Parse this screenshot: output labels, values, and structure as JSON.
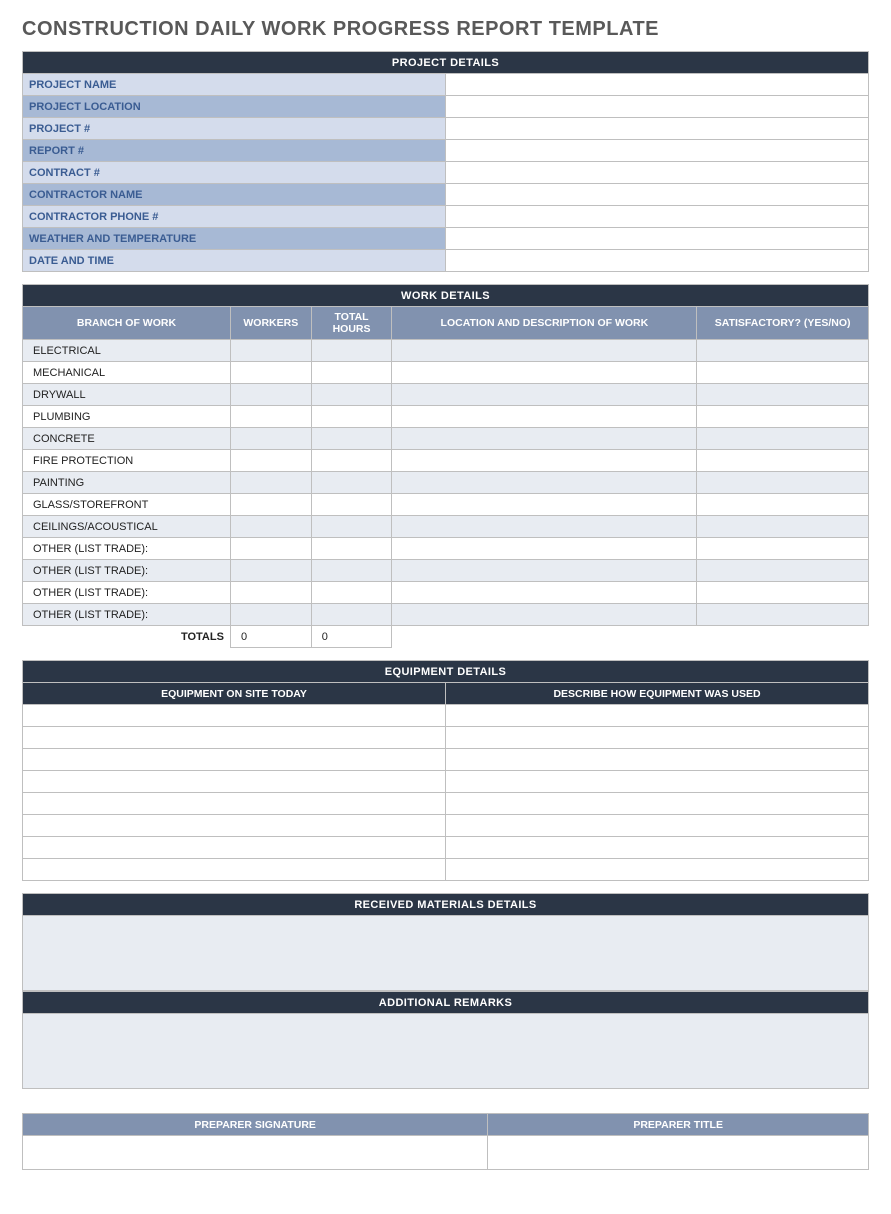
{
  "title": "CONSTRUCTION DAILY WORK PROGRESS REPORT TEMPLATE",
  "sections": {
    "project_details": "PROJECT DETAILS",
    "work_details": "WORK DETAILS",
    "equipment_details": "EQUIPMENT DETAILS",
    "received_materials": "RECEIVED MATERIALS DETAILS",
    "additional_remarks": "ADDITIONAL REMARKS"
  },
  "project_details": {
    "rows": [
      {
        "label": "PROJECT NAME",
        "value": ""
      },
      {
        "label": "PROJECT LOCATION",
        "value": ""
      },
      {
        "label": "PROJECT #",
        "value": ""
      },
      {
        "label": "REPORT #",
        "value": ""
      },
      {
        "label": "CONTRACT #",
        "value": ""
      },
      {
        "label": "CONTRACTOR NAME",
        "value": ""
      },
      {
        "label": "CONTRACTOR PHONE #",
        "value": ""
      },
      {
        "label": "WEATHER AND TEMPERATURE",
        "value": ""
      },
      {
        "label": "DATE AND TIME",
        "value": ""
      }
    ]
  },
  "work_details": {
    "headers": {
      "branch": "BRANCH OF WORK",
      "workers": "WORKERS",
      "hours": "TOTAL HOURS",
      "location": "LOCATION AND DESCRIPTION OF WORK",
      "satisfactory": "SATISFACTORY? (YES/NO)"
    },
    "rows": [
      {
        "branch": "ELECTRICAL",
        "workers": "",
        "hours": "",
        "location": "",
        "satisfactory": ""
      },
      {
        "branch": "MECHANICAL",
        "workers": "",
        "hours": "",
        "location": "",
        "satisfactory": ""
      },
      {
        "branch": "DRYWALL",
        "workers": "",
        "hours": "",
        "location": "",
        "satisfactory": ""
      },
      {
        "branch": "PLUMBING",
        "workers": "",
        "hours": "",
        "location": "",
        "satisfactory": ""
      },
      {
        "branch": "CONCRETE",
        "workers": "",
        "hours": "",
        "location": "",
        "satisfactory": ""
      },
      {
        "branch": "FIRE PROTECTION",
        "workers": "",
        "hours": "",
        "location": "",
        "satisfactory": ""
      },
      {
        "branch": "PAINTING",
        "workers": "",
        "hours": "",
        "location": "",
        "satisfactory": ""
      },
      {
        "branch": "GLASS/STOREFRONT",
        "workers": "",
        "hours": "",
        "location": "",
        "satisfactory": ""
      },
      {
        "branch": "CEILINGS/ACOUSTICAL",
        "workers": "",
        "hours": "",
        "location": "",
        "satisfactory": ""
      },
      {
        "branch": "OTHER (LIST TRADE):",
        "workers": "",
        "hours": "",
        "location": "",
        "satisfactory": ""
      },
      {
        "branch": "OTHER (LIST TRADE):",
        "workers": "",
        "hours": "",
        "location": "",
        "satisfactory": ""
      },
      {
        "branch": "OTHER (LIST TRADE):",
        "workers": "",
        "hours": "",
        "location": "",
        "satisfactory": ""
      },
      {
        "branch": "OTHER (LIST TRADE):",
        "workers": "",
        "hours": "",
        "location": "",
        "satisfactory": ""
      }
    ],
    "totals_label": "TOTALS",
    "totals": {
      "workers": "0",
      "hours": "0"
    }
  },
  "equipment_details": {
    "headers": {
      "onsite": "EQUIPMENT ON SITE TODAY",
      "usage": "DESCRIBE HOW EQUIPMENT WAS USED"
    },
    "rows": [
      {
        "onsite": "",
        "usage": ""
      },
      {
        "onsite": "",
        "usage": ""
      },
      {
        "onsite": "",
        "usage": ""
      },
      {
        "onsite": "",
        "usage": ""
      },
      {
        "onsite": "",
        "usage": ""
      },
      {
        "onsite": "",
        "usage": ""
      },
      {
        "onsite": "",
        "usage": ""
      },
      {
        "onsite": "",
        "usage": ""
      }
    ]
  },
  "received_materials": {
    "value": ""
  },
  "additional_remarks": {
    "value": ""
  },
  "signature": {
    "preparer_signature_label": "PREPARER SIGNATURE",
    "preparer_title_label": "PREPARER TITLE",
    "preparer_signature": "",
    "preparer_title": ""
  }
}
